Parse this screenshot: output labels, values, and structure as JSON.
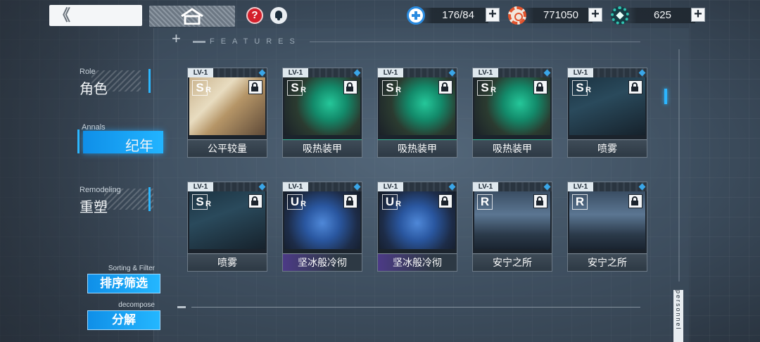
{
  "topbar": {
    "back_label": "《",
    "resources": [
      {
        "icon": "stamina-plus-icon",
        "value": "176/84",
        "color": "#2a8be0"
      },
      {
        "icon": "gear-coin-icon",
        "value": "771050",
        "color": "#e2542e"
      },
      {
        "icon": "crystal-gear-icon",
        "value": "625",
        "color": "#2fc3b0"
      }
    ],
    "add_label": "+"
  },
  "features_title": "FEATURES",
  "nav": {
    "role": {
      "en": "Role",
      "zh": "角色"
    },
    "annals": {
      "en": "Annals",
      "zh": "纪年"
    },
    "remodeling": {
      "en": "Remodeling",
      "zh": "重塑"
    }
  },
  "actions": {
    "sort": {
      "en": "Sorting & Filter",
      "zh": "排序筛选"
    },
    "decompose": {
      "en": "decompose",
      "zh": "分解"
    }
  },
  "side_label": "personnel",
  "cards": [
    {
      "level": "LV-1",
      "rarity": "S",
      "rarity_sub": "R",
      "name": "公平较量"
    },
    {
      "level": "LV-1",
      "rarity": "S",
      "rarity_sub": "R",
      "name": "吸热装甲"
    },
    {
      "level": "LV-1",
      "rarity": "S",
      "rarity_sub": "R",
      "name": "吸热装甲"
    },
    {
      "level": "LV-1",
      "rarity": "S",
      "rarity_sub": "R",
      "name": "吸热装甲"
    },
    {
      "level": "LV-1",
      "rarity": "S",
      "rarity_sub": "R",
      "name": "喷雾"
    },
    {
      "level": "LV-1",
      "rarity": "S",
      "rarity_sub": "R",
      "name": "喷雾"
    },
    {
      "level": "LV-1",
      "rarity": "U",
      "rarity_sub": "R",
      "name": "坚冰般冷彻"
    },
    {
      "level": "LV-1",
      "rarity": "U",
      "rarity_sub": "R",
      "name": "坚冰般冷彻"
    },
    {
      "level": "LV-1",
      "rarity": "R",
      "rarity_sub": "",
      "name": "安宁之所"
    },
    {
      "level": "LV-1",
      "rarity": "R",
      "rarity_sub": "",
      "name": "安宁之所"
    }
  ]
}
